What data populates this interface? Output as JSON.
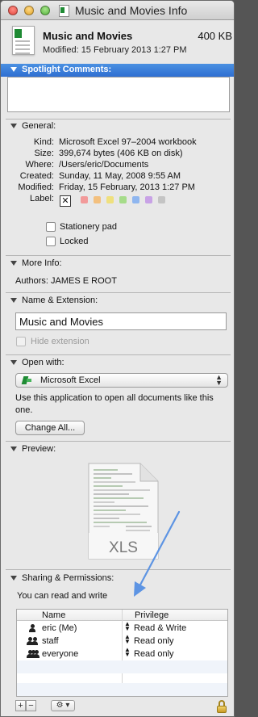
{
  "window": {
    "title": "Music and Movies Info"
  },
  "header": {
    "file_name": "Music and Movies",
    "file_size": "400 KB",
    "modified": "Modified: 15 February 2013 1:27 PM"
  },
  "spotlight": {
    "label": "Spotlight Comments:"
  },
  "general": {
    "label": "General:",
    "rows": [
      {
        "key": "Kind:",
        "value": "Microsoft Excel 97–2004 workbook"
      },
      {
        "key": "Size:",
        "value": "399,674 bytes (406 KB on disk)"
      },
      {
        "key": "Where:",
        "value": "/Users/eric/Documents"
      },
      {
        "key": "Created:",
        "value": "Sunday, 11 May, 2008 9:55 AM"
      },
      {
        "key": "Modified:",
        "value": "Friday, 15 February, 2013 1:27 PM"
      }
    ],
    "label_key": "Label:",
    "label_none": "✕",
    "label_colors": [
      "#f29a9a",
      "#f3c07e",
      "#efe07e",
      "#a6dc8a",
      "#8fb6ef",
      "#c8a2e6",
      "#c4c4c4"
    ],
    "stationery_pad": "Stationery pad",
    "locked": "Locked"
  },
  "more_info": {
    "label": "More Info:",
    "authors": "Authors: JAMES E ROOT"
  },
  "name_ext": {
    "label": "Name & Extension:",
    "value": "Music and Movies",
    "hide_extension": "Hide extension"
  },
  "open_with": {
    "label": "Open with:",
    "app": "Microsoft Excel",
    "info": "Use this application to open all documents like this one.",
    "change_all": "Change All..."
  },
  "preview": {
    "label": "Preview:",
    "badge": "XLS"
  },
  "sharing": {
    "label": "Sharing & Permissions:",
    "summary": "You can read and write",
    "col_name": "Name",
    "col_privilege": "Privilege",
    "rows": [
      {
        "name": "eric (Me)",
        "privilege": "Read & Write"
      },
      {
        "name": "staff",
        "privilege": "Read only"
      },
      {
        "name": "everyone",
        "privilege": "Read only"
      }
    ],
    "add": "+",
    "remove": "−",
    "action": "⚙ ▾"
  },
  "icons": [
    "document-icon",
    "excel-icon",
    "lock-icon",
    "gear-icon",
    "user-icon",
    "group-icon"
  ]
}
